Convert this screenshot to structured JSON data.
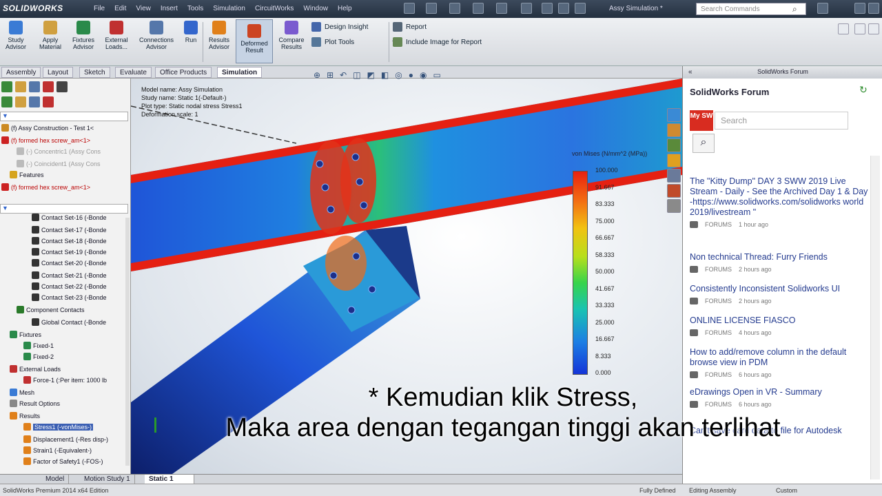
{
  "app": {
    "logo": "SOLIDWORKS",
    "document_title": "Assy Simulation *",
    "search_placeholder": "Search Commands"
  },
  "menu": [
    "File",
    "Edit",
    "View",
    "Insert",
    "Tools",
    "Simulation",
    "CircuitWorks",
    "Window",
    "Help"
  ],
  "command_manager": {
    "buttons": [
      {
        "label": "Study Advisor",
        "color": "#3a7bd5"
      },
      {
        "label": "Apply Material",
        "color": "#d0a040"
      },
      {
        "label": "Fixtures Advisor",
        "color": "#2a8a4a"
      },
      {
        "label": "External Loads...",
        "color": "#c03030"
      },
      {
        "label": "Connections Advisor",
        "color": "#5577aa"
      },
      {
        "label": "Run",
        "color": "#3366cc"
      },
      {
        "label": "Results Advisor",
        "color": "#e0801a"
      },
      {
        "label": "Deformed Result",
        "color": "#cc4422"
      },
      {
        "label": "Compare Results",
        "color": "#7a5acf"
      }
    ],
    "small": [
      "Design Insight",
      "Plot Tools",
      "Report",
      "Include Image for Report"
    ]
  },
  "tabs": [
    "Assembly",
    "Layout",
    "Sketch",
    "Evaluate",
    "Office Products",
    "Simulation"
  ],
  "tree": [
    {
      "label": "(f) Assy Construction - Test 1<",
      "cls": "",
      "indent": 2,
      "color": "#cc8a22"
    },
    {
      "label": "(f) formed hex screw_am<1>",
      "cls": "err",
      "indent": 2,
      "color": "#c22"
    },
    {
      "label": "(-) Concentric1 (Assy Cons",
      "cls": "dim",
      "indent": 24,
      "color": "#bbb"
    },
    {
      "label": "(-) Coincident1 (Assy Cons",
      "cls": "dim",
      "indent": 24,
      "color": "#bbb"
    },
    {
      "label": "Features",
      "cls": "",
      "indent": 14,
      "color": "#d6a41e"
    },
    {
      "label": "(f) formed hex screw_am<1>",
      "cls": "err",
      "indent": 2,
      "color": "#c22"
    },
    {
      "label": "Contact Set-16 (-Bonde",
      "cls": "",
      "indent": 46,
      "color": "#333"
    },
    {
      "label": "Contact Set-17 (-Bonde",
      "cls": "",
      "indent": 46,
      "color": "#333"
    },
    {
      "label": "Contact Set-18 (-Bonde",
      "cls": "",
      "indent": 46,
      "color": "#333"
    },
    {
      "label": "Contact Set-19 (-Bonde",
      "cls": "",
      "indent": 46,
      "color": "#333"
    },
    {
      "label": "Contact Set-20 (-Bonde",
      "cls": "",
      "indent": 46,
      "color": "#333"
    },
    {
      "label": "Contact Set-21 (-Bonde",
      "cls": "",
      "indent": 46,
      "color": "#333"
    },
    {
      "label": "Contact Set-22 (-Bonde",
      "cls": "",
      "indent": 46,
      "color": "#333"
    },
    {
      "label": "Contact Set-23 (-Bonde",
      "cls": "",
      "indent": 46,
      "color": "#333"
    },
    {
      "label": "Component Contacts",
      "cls": "",
      "indent": 24,
      "color": "#2a7a2a"
    },
    {
      "label": "Global Contact (-Bonde",
      "cls": "",
      "indent": 46,
      "color": "#333"
    },
    {
      "label": "Fixtures",
      "cls": "",
      "indent": 14,
      "color": "#2a8a4a"
    },
    {
      "label": "Fixed-1",
      "cls": "",
      "indent": 34,
      "color": "#2a8a4a"
    },
    {
      "label": "Fixed-2",
      "cls": "",
      "indent": 34,
      "color": "#2a8a4a"
    },
    {
      "label": "External Loads",
      "cls": "",
      "indent": 14,
      "color": "#c03030"
    },
    {
      "label": "Force-1 (:Per item: 1000 lb",
      "cls": "",
      "indent": 34,
      "color": "#c03030"
    },
    {
      "label": "Mesh",
      "cls": "",
      "indent": 14,
      "color": "#3a7bd5"
    },
    {
      "label": "Result Options",
      "cls": "",
      "indent": 14,
      "color": "#888"
    },
    {
      "label": "Results",
      "cls": "",
      "indent": 14,
      "color": "#e0801a"
    },
    {
      "label": "Stress1 (-vonMises-)",
      "cls": "hl",
      "indent": 34,
      "color": "#e0801a"
    },
    {
      "label": "Displacement1 (-Res disp-)",
      "cls": "",
      "indent": 34,
      "color": "#e0801a"
    },
    {
      "label": "Strain1 (-Equivalent-)",
      "cls": "",
      "indent": 34,
      "color": "#e0801a"
    },
    {
      "label": "Factor of Safety1 (-FOS-)",
      "cls": "",
      "indent": 34,
      "color": "#e0801a"
    }
  ],
  "model_info": [
    "Model name: Assy Simulation",
    "Study name: Static 1(-Default-)",
    "Plot type: Static nodal stress Stress1",
    "Deformation scale: 1"
  ],
  "legend": {
    "title": "von Mises (N/mm^2 (MPa))",
    "values": [
      "100.000",
      "91.667",
      "83.333",
      "75.000",
      "66.667",
      "58.333",
      "50.000",
      "41.667",
      "33.333",
      "25.000",
      "16.667",
      "8.333",
      "0.000"
    ]
  },
  "forum": {
    "header": "SolidWorks Forum",
    "title": "SolidWorks Forum",
    "badge": "My SW",
    "search_placeholder": "Search",
    "items": [
      {
        "title": "The \"Kitty Dump\" DAY 3 SWW 2019 Live Stream - Daily - See the Archived Day 1 & Day 2 -https://www.solidworks.com/solidworks world 2019/livestream \"",
        "source": "FORUMS",
        "time": "1 hour ago"
      },
      {
        "title": "Non technical Thread: Furry Friends",
        "source": "FORUMS",
        "time": "2 hours ago"
      },
      {
        "title": "Consistently Inconsistent Solidworks UI",
        "source": "FORUMS",
        "time": "2 hours ago"
      },
      {
        "title": "ONLINE LICENSE FIASCO",
        "source": "FORUMS",
        "time": "4 hours ago"
      },
      {
        "title": "How to add/remove column in the default browse view in PDM",
        "source": "FORUMS",
        "time": "6 hours ago"
      },
      {
        "title": "eDrawings Open in VR - Summary",
        "source": "FORUMS",
        "time": "6 hours ago"
      },
      {
        "title": "Can't save card data to file for Autodesk",
        "source": "FORUMS",
        "time": ""
      }
    ]
  },
  "bottom_tabs": [
    "Model",
    "Motion Study 1",
    "Static 1"
  ],
  "status": {
    "app": "SolidWorks Premium 2014 x64 Edition",
    "state": "Fully Defined",
    "mode": "Editing Assembly",
    "units": "Custom"
  },
  "subtitles": [
    "* Kemudian klik Stress,",
    "Maka area dengan tegangan tinggi akan terlihat"
  ]
}
